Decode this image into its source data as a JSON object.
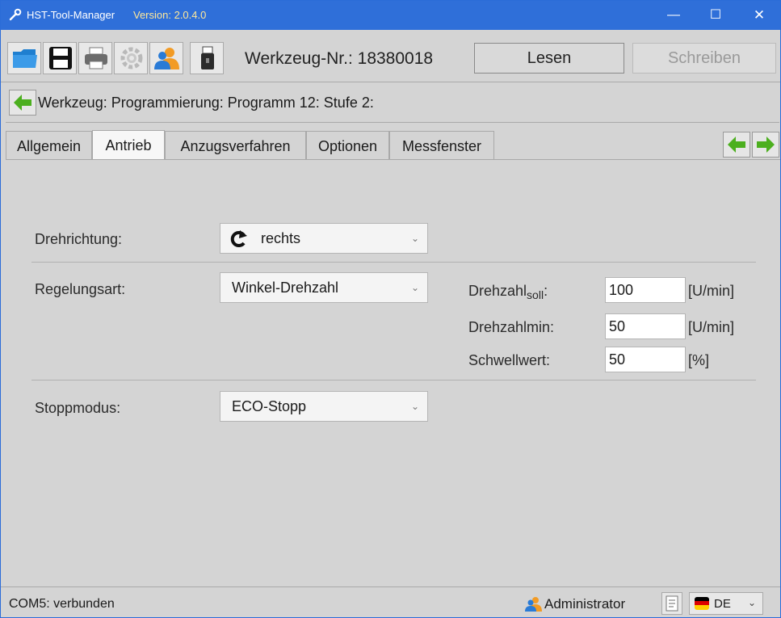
{
  "window": {
    "title": "HST-Tool-Manager",
    "version": "Version: 2.0.4.0",
    "minimize": "—",
    "maximize": "☐",
    "close": "✕"
  },
  "toolbar": {
    "tool_number": "Werkzeug-Nr.: 18380018",
    "read_label": "Lesen",
    "write_label": "Schreiben",
    "icons": [
      "folder-icon",
      "save-icon",
      "print-icon",
      "settings-icon",
      "users-icon",
      "usb-icon"
    ]
  },
  "breadcrumb": {
    "text": "Werkzeug: Programmierung: Programm 12: Stufe 2:"
  },
  "tabs": [
    {
      "label": "Allgemein",
      "active": false
    },
    {
      "label": "Antrieb",
      "active": true
    },
    {
      "label": "Anzugsverfahren",
      "active": false
    },
    {
      "label": "Optionen",
      "active": false
    },
    {
      "label": "Messfenster",
      "active": false
    }
  ],
  "form": {
    "direction": {
      "label": "Drehrichtung:",
      "value": "rechts",
      "icon": "clockwise-arrow-icon"
    },
    "control": {
      "label": "Regelungsart:",
      "value": "Winkel-Drehzahl"
    },
    "stop": {
      "label": "Stoppmodus:",
      "value": "ECO-Stopp"
    },
    "speed_target": {
      "label_main": "Drehzahl",
      "label_sub": "soll",
      "label_end": ":",
      "value": "100",
      "unit": "[U/min]"
    },
    "speed_min": {
      "label": "Drehzahlmin:",
      "value": "50",
      "unit": "[U/min]"
    },
    "threshold": {
      "label": "Schwellwert:",
      "value": "50",
      "unit": "[%]"
    }
  },
  "status": {
    "connection": "COM5: verbunden",
    "user": "Administrator",
    "language": "DE",
    "colors": {
      "titlebar": "#2f6fd9",
      "version_text": "#ffe89a",
      "arrow_green": "#4caf1f"
    }
  }
}
